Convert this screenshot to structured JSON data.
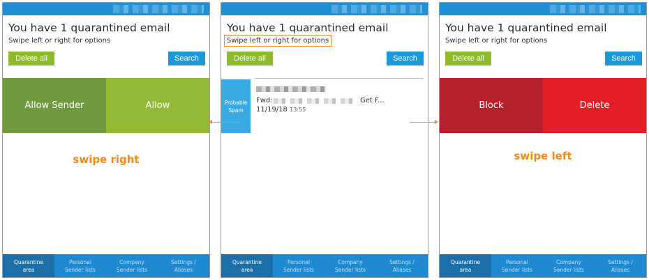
{
  "screens": [
    {
      "title": "You have 1 quarantined email",
      "subtitle": "Swipe left or right for options",
      "delete_all_label": "Delete all",
      "search_label": "Search",
      "actions": [
        "Allow Sender",
        "Allow"
      ],
      "caption": "swipe right"
    },
    {
      "title": "You have 1 quarantined email",
      "subtitle": "Swipe left or right for options",
      "delete_all_label": "Delete all",
      "search_label": "Search",
      "email": {
        "tag_line1": "Probable",
        "tag_line2": "Spam",
        "subject_prefix": "Fwd:",
        "subject_suffix": "Get F...",
        "date": "11/19/18",
        "time": "13:55"
      }
    },
    {
      "title": "You have 1 quarantined email",
      "subtitle": "Swipe left or right for options",
      "delete_all_label": "Delete all",
      "search_label": "Search",
      "actions": [
        "Block",
        "Delete"
      ],
      "caption": "swipe left"
    }
  ],
  "nav": [
    {
      "line1": "Quarantine",
      "line2": "area"
    },
    {
      "line1": "Personal",
      "line2": "Sender lists"
    },
    {
      "line1": "Company",
      "line2": "Sender lists"
    },
    {
      "line1": "Settings /",
      "line2": "Aliases"
    }
  ],
  "colors": {
    "brand_blue": "#1f8ad2",
    "allow_green": "#93b937",
    "allow_sender_green": "#6f9b3e",
    "block_red": "#b5222b",
    "delete_red": "#e51d27",
    "annotation_orange": "#f28a15"
  }
}
